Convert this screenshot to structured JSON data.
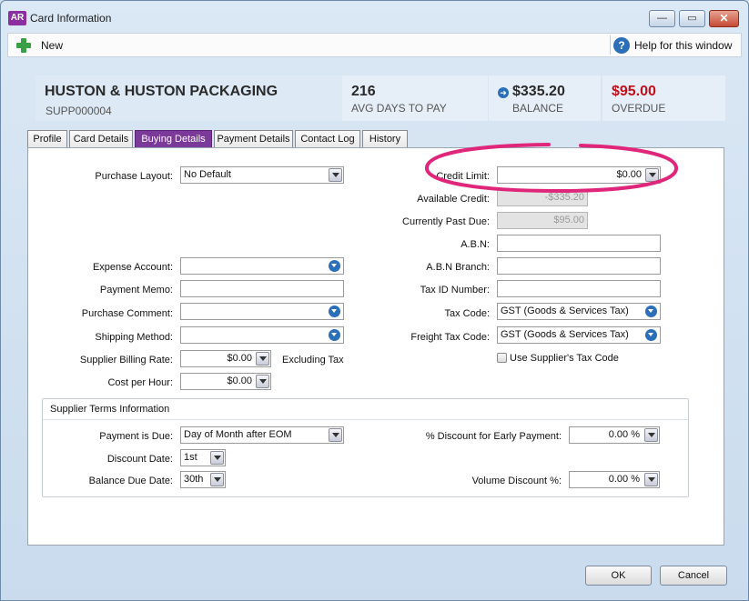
{
  "window": {
    "title": "Card Information",
    "app_icon": "AR"
  },
  "toolbar": {
    "new_label": "New",
    "help_label": "Help for this window"
  },
  "header": {
    "company_name": "HUSTON & HUSTON PACKAGING",
    "card_id": "SUPP000004",
    "avg_days": {
      "value": "216",
      "label": "AVG DAYS TO PAY"
    },
    "balance": {
      "value": "$335.20",
      "label": "BALANCE"
    },
    "overdue": {
      "value": "$95.00",
      "label": "OVERDUE",
      "color": "#c0101b"
    }
  },
  "tabs": [
    "Profile",
    "Card Details",
    "Buying Details",
    "Payment Details",
    "Contact Log",
    "History"
  ],
  "active_tab": "Buying Details",
  "left": {
    "purchase_layout": {
      "label": "Purchase Layout:",
      "value": "No Default"
    },
    "expense_account": {
      "label": "Expense Account:",
      "value": ""
    },
    "payment_memo": {
      "label": "Payment Memo:",
      "value": ""
    },
    "purchase_comment": {
      "label": "Purchase Comment:",
      "value": ""
    },
    "shipping_method": {
      "label": "Shipping Method:",
      "value": ""
    },
    "billing_rate": {
      "label": "Supplier Billing Rate:",
      "value": "$0.00",
      "suffix": "Excluding Tax"
    },
    "cost_per_hour": {
      "label": "Cost per Hour:",
      "value": "$0.00"
    }
  },
  "right": {
    "credit_limit": {
      "label": "Credit Limit:",
      "value": "$0.00"
    },
    "available_credit": {
      "label": "Available Credit:",
      "value": "-$335.20"
    },
    "past_due": {
      "label": "Currently Past Due:",
      "value": "$95.00"
    },
    "abn": {
      "label": "A.B.N:",
      "value": ""
    },
    "abn_branch": {
      "label": "A.B.N Branch:",
      "value": ""
    },
    "tax_id": {
      "label": "Tax ID Number:",
      "value": ""
    },
    "tax_code": {
      "label": "Tax Code:",
      "value": "GST (Goods & Services Tax)"
    },
    "freight_tax_code": {
      "label": "Freight Tax Code:",
      "value": "GST (Goods & Services Tax)"
    },
    "use_supplier_tax": {
      "label": "Use Supplier's Tax Code",
      "checked": false
    }
  },
  "terms": {
    "title": "Supplier Terms Information",
    "payment_due": {
      "label": "Payment is Due:",
      "value": "Day of Month after EOM"
    },
    "discount_date": {
      "label": "Discount Date:",
      "value": "1st"
    },
    "balance_due_date": {
      "label": "Balance Due Date:",
      "value": "30th"
    },
    "early_discount": {
      "label": "% Discount for Early Payment:",
      "value": "0.00 %"
    },
    "volume_discount": {
      "label": "Volume Discount %:",
      "value": "0.00 %"
    }
  },
  "buttons": {
    "ok": "OK",
    "cancel": "Cancel"
  },
  "colors": {
    "highlight": "#e0267a",
    "active_tab": "#7b3a9a"
  }
}
